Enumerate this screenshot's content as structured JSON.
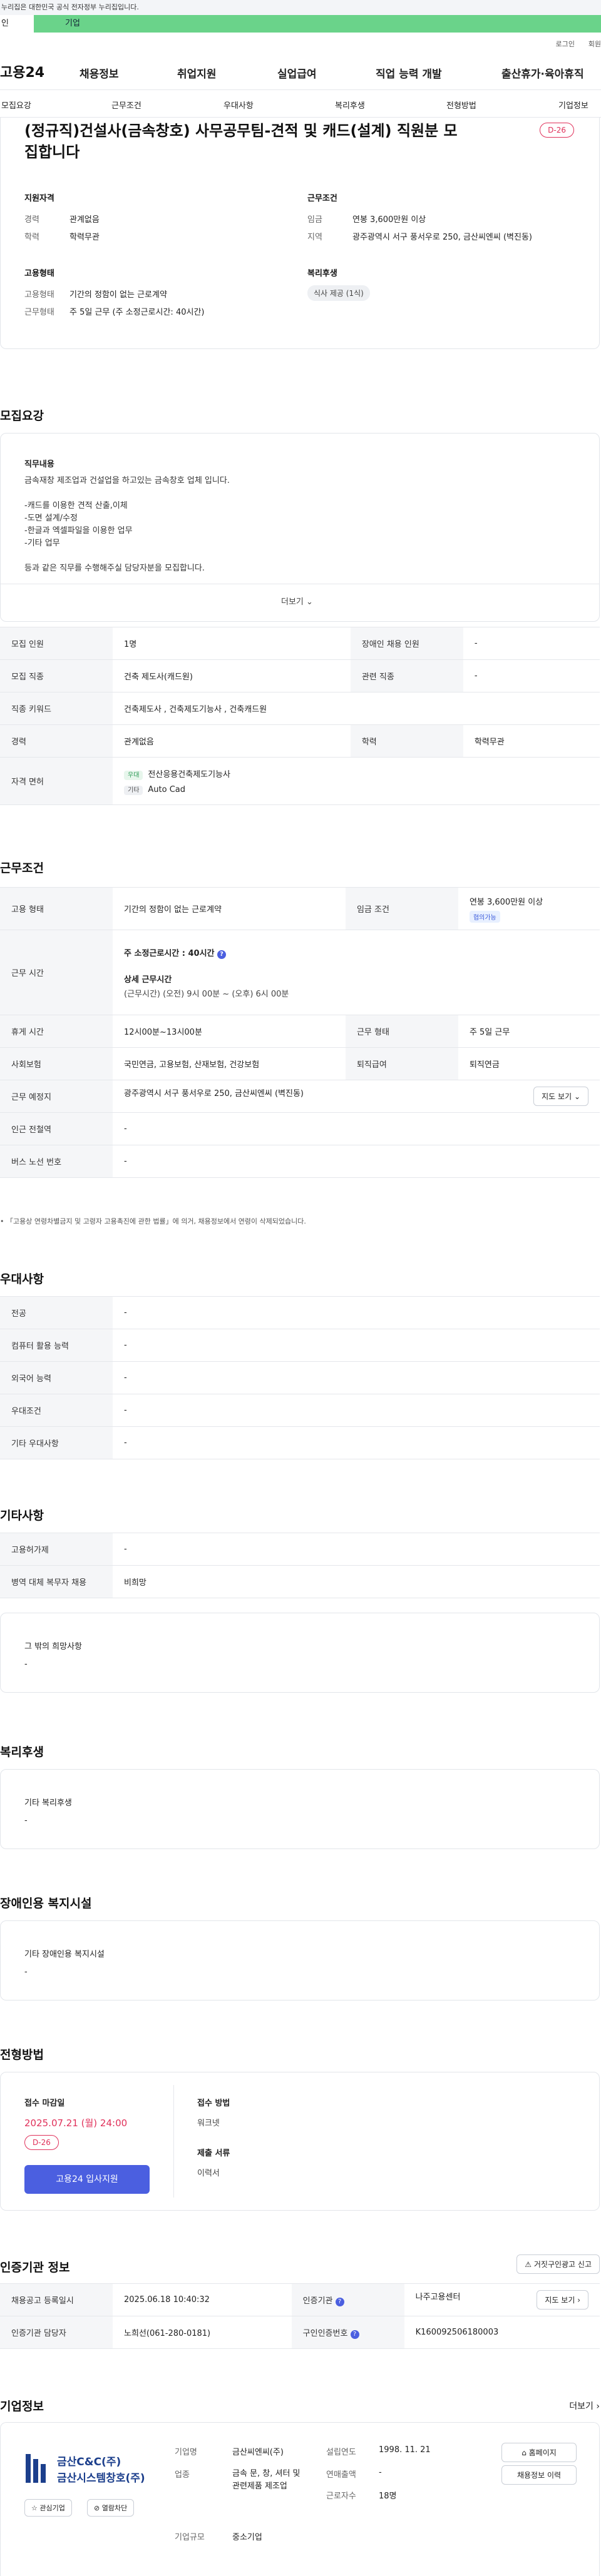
{
  "topbar": {
    "notice": "누리집은 대한민국 공식 전자정부 누리집입니다."
  },
  "tabs": {
    "personal": "인",
    "company": "기업"
  },
  "util": {
    "login": "로그인",
    "join": "회원"
  },
  "gnb": {
    "logo": "고용24",
    "menu": [
      "채용정보",
      "취업지원",
      "실업급여",
      "직업 능력 개발",
      "출산휴가·육아휴직"
    ]
  },
  "subnav": [
    "모집요강",
    "근무조건",
    "우대사항",
    "복리후생",
    "전형방법",
    "기업정보"
  ],
  "job": {
    "title": "(정규직)건설사(금속창호) 사무공무팀-견적 및 캐드(설계) 직원분 모집합니다",
    "dday": "D-26",
    "qual_heading": "지원자격",
    "qual": [
      {
        "k": "경력",
        "v": "관계없음"
      },
      {
        "k": "학력",
        "v": "학력무관"
      }
    ],
    "cond_heading": "근무조건",
    "cond": [
      {
        "k": "임금",
        "v": "연봉 3,600만원 이상"
      },
      {
        "k": "지역",
        "v": "광주광역시 서구 풍서우로 250, 금산씨엔씨 (벽진동)"
      }
    ],
    "emp_heading": "고용형태",
    "emp": [
      {
        "k": "고용형태",
        "v": "기간의 정함이 없는 근로계약"
      },
      {
        "k": "근무형태",
        "v": "주 5일 근무 (주 소정근로시간: 40시간)"
      }
    ],
    "welfare_heading": "복리후생",
    "welfare_pill": "식사 제공 (1식)"
  },
  "recruit": {
    "heading": "모집요강",
    "duty_label": "직무내용",
    "duty_lines": [
      "금속재창 제조업과 건설업을 하고있는 금속창호 업체 입니다.",
      "",
      "-캐드를 이용한 견적 산출,이체",
      "-도면 설계/수정",
      "-한글과 엑셀파일을 이용한 업무",
      "-기타 업무",
      "",
      "등과 같은 직무를 수행해주실 담당자분을 모집합니다."
    ],
    "more": "더보기",
    "rows": [
      {
        "k1": "모집 인원",
        "v1": "1명",
        "k2": "장애인 채용 인원",
        "v2": "-"
      },
      {
        "k1": "모집 직종",
        "v1": "건축 제도사(캐드원)",
        "k2": "관련 직종",
        "v2": "-"
      }
    ],
    "keyword_k": "직종 키워드",
    "keyword_v": "건축제도사 , 건축제도기능사 , 건축캐드원",
    "career_k": "경력",
    "career_v": "관계없음",
    "edu_k": "학력",
    "edu_v": "학력무관",
    "cert_k": "자격 면허",
    "cert": [
      {
        "badge": "우대",
        "name": "전산응용건축제도기능사"
      },
      {
        "badge": "기타",
        "name": "Auto Cad"
      }
    ]
  },
  "work": {
    "heading": "근무조건",
    "type_k": "고용 형태",
    "type_v": "기간의 정함이 없는 근로계약",
    "wage_k": "임금 조건",
    "wage_v": "연봉 3,600만원 이상",
    "wage_tag": "협의가능",
    "hours_k": "근무 시간",
    "hours_total": "주 소정근로시간 : 40시간",
    "hours_detail_label": "상세 근무시간",
    "hours_detail": "(근무시간) (오전) 9시 00분 ~ (오후) 6시 00분",
    "rest_k": "휴게 시간",
    "rest_v": "12시00분~13시00분",
    "form_k": "근무 형태",
    "form_v": "주 5일 근무",
    "insure_k": "사회보험",
    "insure_v": "국민연금, 고용보험, 산재보험, 건강보험",
    "retire_k": "퇴직급여",
    "retire_v": "퇴직연금",
    "place_k": "근무 예정지",
    "place_v": "광주광역시 서구 풍서우로 250, 금산씨엔씨 (벽진동)",
    "map": "지도 보기",
    "subway_k": "인근 전철역",
    "subway_v": "-",
    "bus_k": "버스 노선 번호",
    "bus_v": "-",
    "note": "「고용상 연령차별금지 및 고령자 고용촉진에 관한 법률」에 의거, 채용정보에서 연령이 삭제되었습니다."
  },
  "pref": {
    "heading": "우대사항",
    "rows": [
      {
        "k": "전공",
        "v": "-"
      },
      {
        "k": "컴퓨터 활용 능력",
        "v": "-"
      },
      {
        "k": "외국어 능력",
        "v": "-"
      },
      {
        "k": "우대조건",
        "v": "-"
      },
      {
        "k": "기타 우대사항",
        "v": "-"
      }
    ]
  },
  "etc": {
    "heading": "기타사항",
    "rows": [
      {
        "k": "고용허가제",
        "v": "-"
      },
      {
        "k": "병역 대체 복무자 채용",
        "v": "비희망"
      }
    ],
    "other_label": "그 밖의 희망사항",
    "other_v": "-"
  },
  "benefit": {
    "heading": "복리후생",
    "label": "기타 복리후생",
    "v": "-"
  },
  "disab": {
    "heading": "장애인용 복지시설",
    "label": "기타 장애인용 복지시설",
    "v": "-"
  },
  "process": {
    "heading": "전형방법",
    "deadline_label": "접수 마감일",
    "deadline": "2025.07.21 (월) 24:00",
    "dday": "D-26",
    "apply_btn": "고용24 입사지원",
    "method_label": "접수 방법",
    "method_v": "워크넷",
    "docs_label": "제출 서류",
    "docs_v": "이력서"
  },
  "cert": {
    "heading": "인증기관 정보",
    "report": "거짓구인광고 신고",
    "reg_k": "채용공고 등록일시",
    "reg_v": "2025.06.18 10:40:32",
    "org_k": "인증기관",
    "org_v": "나주고용센터",
    "map": "지도 보기",
    "mgr_k": "인증기관 담당자",
    "mgr_v": "노희선(061-280-0181)",
    "id_k": "구인인증번호",
    "id_v": "K160092506180003"
  },
  "company": {
    "heading": "기업정보",
    "more": "더보기",
    "logo_line1": "금산C&C(주)",
    "logo_line2": "금산시스템창호(주)",
    "fav": "관심기업",
    "block": "열람차단",
    "name_k": "기업명",
    "name_v": "금산씨엔씨(주)",
    "est_k": "설립연도",
    "est_v": "1998. 11. 21",
    "biz_k": "업종",
    "biz_v": "금속 문, 창, 셔터 및 관련제품 제조업",
    "sales_k": "연매출액",
    "sales_v": "-",
    "emp_k": "근로자수",
    "emp_v": "18명",
    "size_k": "기업규모",
    "size_v": "중소기업",
    "home": "홈페이지",
    "jobs": "채용정보 이력"
  },
  "colors": {
    "accent": "#4b5fe0",
    "dday": "#e0305a",
    "tab": "#6ad38a"
  }
}
